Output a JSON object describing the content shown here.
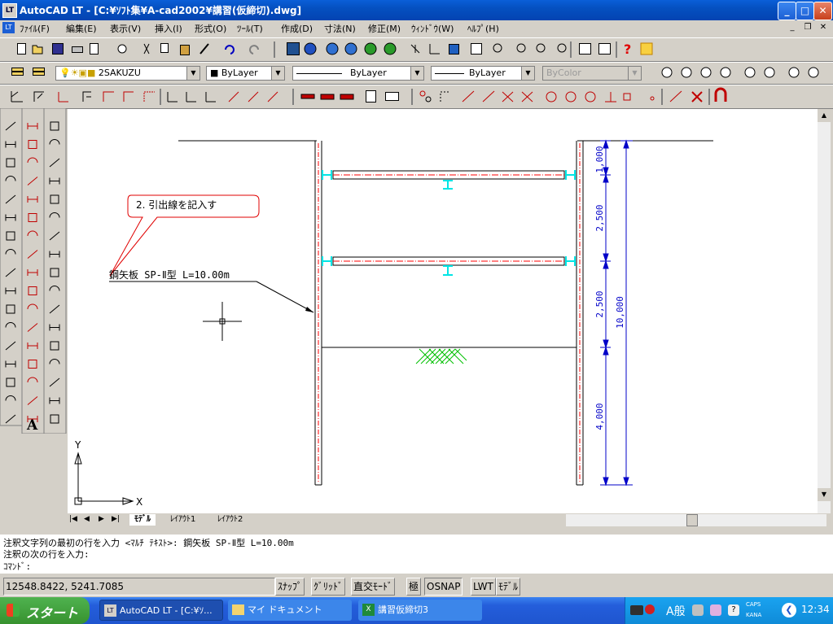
{
  "window": {
    "app_icon": "LT",
    "title": "AutoCAD LT - [C:¥ｿﾌﾄ集¥A-cad2002¥講習(仮締切).dwg]",
    "buttons": {
      "minimize": "_",
      "maximize": "□",
      "close": "✕"
    }
  },
  "menubar": {
    "items": [
      "ﾌｧｲﾙ(F)",
      "編集(E)",
      "表示(V)",
      "挿入(I)",
      "形式(O)",
      "ﾂｰﾙ(T)",
      "作成(D)",
      "寸法(N)",
      "修正(M)",
      "ｳｨﾝﾄﾞｳ(W)",
      "ﾍﾙﾌﾟ(H)"
    ],
    "mdi_buttons": [
      "_",
      "❐",
      "✕"
    ]
  },
  "layers_toolbar": {
    "layer": "2SAKUZU",
    "color": "ByLayer",
    "linetype": "ByLayer",
    "lineweight": "ByLayer",
    "plotstyle": "ByColor"
  },
  "drawing": {
    "callout_text": "2. 引出線を記入す",
    "leader_text": "鋼矢板 SP-Ⅱ型 L=10.00m",
    "dimensions": [
      "1,000",
      "2,500",
      "2,500",
      "4,000",
      "10,000"
    ],
    "ucs": {
      "y": "Y",
      "x": "X"
    },
    "colors": {
      "sheet_pile": "#000000",
      "centerline": "#ff0000",
      "strut_end": "#00e5e5",
      "dimension": "#0000c8",
      "hatch": "#00c000"
    }
  },
  "layout_tabs": [
    "ﾓﾃﾞﾙ",
    "ﾚｲｱｳﾄ1",
    "ﾚｲｱｳﾄ2"
  ],
  "command": {
    "line1": "注釈文字列の最初の行を入力 <ﾏﾙﾁ ﾃｷｽﾄ>: 鋼矢板 SP-Ⅱ型 L=10.00m",
    "line2": "注釈の次の行を入力:",
    "prompt": "ｺﾏﾝﾄﾞ:"
  },
  "status": {
    "coords": "12548.8422, 5241.7085",
    "toggles": [
      "ｽﾅｯﾌﾟ",
      "ｸﾞﾘｯﾄﾞ",
      "直交ﾓｰﾄﾞ",
      "極",
      "OSNAP",
      "LWT",
      "ﾓﾃﾞﾙ"
    ]
  },
  "taskbar": {
    "start": "スタート",
    "items": [
      "AutoCAD LT - [C:¥ｿ...",
      "マイ ドキュメント",
      "講習仮締切3"
    ],
    "tray_text": "A般",
    "caps": "CAPS",
    "kana": "KANA",
    "clock": "12:34"
  }
}
